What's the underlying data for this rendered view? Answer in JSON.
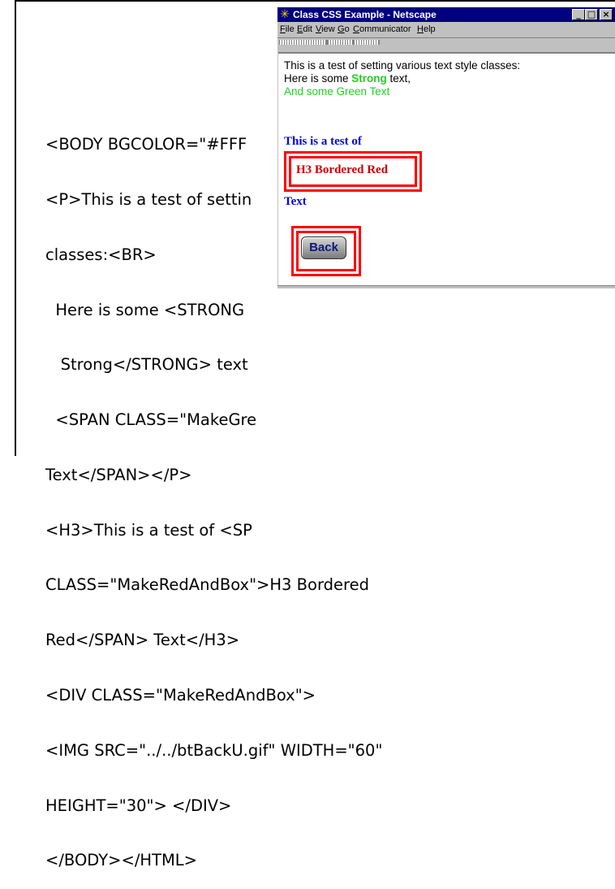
{
  "code": {
    "lines": [
      "<BODY BGCOLOR=\"#FFF",
      "<P>This is a test of settin",
      "classes:<BR>",
      "  Here is some <STRONG",
      "   Strong</STRONG> text",
      "  <SPAN CLASS=\"MakeGre",
      "Text</SPAN></P>",
      "<H3>This is a test of <SP",
      "CLASS=\"MakeRedAndBox\">H3 Bordered",
      "Red</SPAN> Text</H3>",
      "<DIV CLASS=\"MakeRedAndBox\">",
      "<IMG SRC=\"../../btBackU.gif\" WIDTH=\"60\"",
      "HEIGHT=\"30\"> </DIV>",
      "</BODY></HTML>"
    ]
  },
  "browser": {
    "title": "Class CSS Example - Netscape",
    "icon": "netscape-star-icon",
    "buttons": {
      "minimize": "_",
      "maximize": "□",
      "close": "×"
    },
    "menu": [
      "File",
      "Edit",
      "View",
      "Go",
      "Communicator",
      "Help"
    ],
    "menu_access_keys": [
      "F",
      "E",
      "V",
      "G",
      "C",
      "H"
    ]
  },
  "page": {
    "line1": "This is a test of setting various text style classes:",
    "line2_prefix": "Here is some ",
    "line2_strong": "Strong",
    "line2_suffix": " text,",
    "line3": "And some Green Text",
    "h3_prefix": "This is a test of",
    "h3_boxed": "H3 Bordered Red",
    "h3_suffix": "Text",
    "back_label": "Back"
  },
  "colors": {
    "title_bar": "#000080",
    "green_text": "#20d020",
    "heading_blue": "#0000ee",
    "box_red": "#ff0000"
  }
}
